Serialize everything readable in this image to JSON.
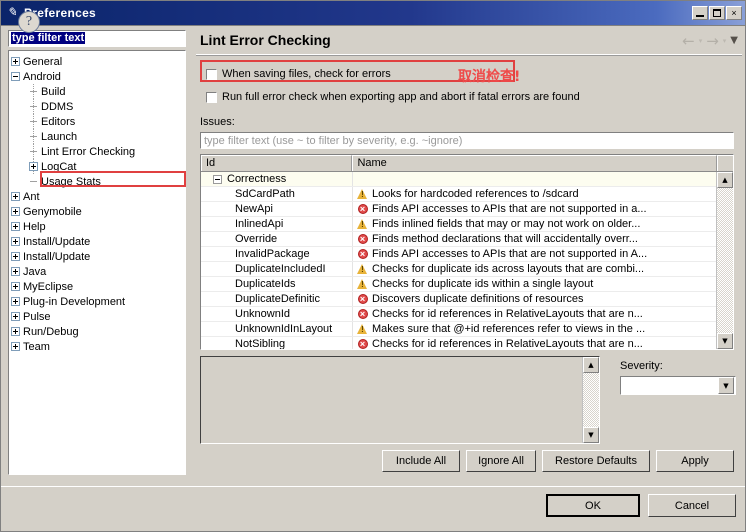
{
  "window": {
    "title": "Preferences",
    "icon": "preferences-icon",
    "buttons": {
      "minimize": "minimize-icon",
      "maximize": "maximize-icon",
      "close": "×"
    }
  },
  "sidebar": {
    "filter": {
      "value": "type filter text",
      "placeholder": "type filter text"
    },
    "tree": [
      {
        "label": "General",
        "level": 0,
        "toggle": "plus"
      },
      {
        "label": "Android",
        "level": 0,
        "toggle": "minus"
      },
      {
        "label": "Build",
        "level": 1,
        "toggle": "none"
      },
      {
        "label": "DDMS",
        "level": 1,
        "toggle": "none"
      },
      {
        "label": "Editors",
        "level": 1,
        "toggle": "none"
      },
      {
        "label": "Launch",
        "level": 1,
        "toggle": "none"
      },
      {
        "label": "Lint Error Checking",
        "level": 1,
        "toggle": "none",
        "highlighted": true
      },
      {
        "label": "LogCat",
        "level": 1,
        "toggle": "plus"
      },
      {
        "label": "Usage Stats",
        "level": 1,
        "toggle": "none"
      },
      {
        "label": "Ant",
        "level": 0,
        "toggle": "plus"
      },
      {
        "label": "Genymobile",
        "level": 0,
        "toggle": "plus"
      },
      {
        "label": "Help",
        "level": 0,
        "toggle": "plus"
      },
      {
        "label": "Install/Update",
        "level": 0,
        "toggle": "plus"
      },
      {
        "label": "Install/Update",
        "level": 0,
        "toggle": "plus"
      },
      {
        "label": "Java",
        "level": 0,
        "toggle": "plus"
      },
      {
        "label": "MyEclipse",
        "level": 0,
        "toggle": "plus"
      },
      {
        "label": "Plug-in Development",
        "level": 0,
        "toggle": "plus"
      },
      {
        "label": "Pulse",
        "level": 0,
        "toggle": "plus"
      },
      {
        "label": "Run/Debug",
        "level": 0,
        "toggle": "plus"
      },
      {
        "label": "Team",
        "level": 0,
        "toggle": "plus"
      }
    ]
  },
  "main": {
    "title": "Lint Error Checking",
    "nav": {
      "back": "←",
      "back_caret": "▾",
      "forward": "→",
      "forward_caret": "▾",
      "menu": "▼"
    },
    "checkboxes": [
      {
        "label": "When saving files, check for errors",
        "checked": false,
        "highlighted": true
      },
      {
        "label": "Run full error check when exporting app and abort if fatal errors are found",
        "checked": false,
        "highlighted": false
      }
    ],
    "annotation": {
      "text": "取消检查!",
      "color": "#ef4a4a"
    },
    "issues": {
      "label": "Issues:",
      "filter_placeholder": "type filter text (use ~ to filter by severity, e.g. ~ignore)",
      "columns": [
        "Id",
        "Name"
      ],
      "rows": [
        {
          "id": "Correctness",
          "name": "",
          "icon": "none",
          "group": true
        },
        {
          "id": "SdCardPath",
          "name": "Looks for hardcoded references to /sdcard",
          "icon": "warning",
          "group": false
        },
        {
          "id": "NewApi",
          "name": "Finds API accesses to APIs that are not supported in a...",
          "icon": "error",
          "group": false
        },
        {
          "id": "InlinedApi",
          "name": "Finds inlined fields that may or may not work on older...",
          "icon": "warning",
          "group": false
        },
        {
          "id": "Override",
          "name": "Finds method declarations that will accidentally overr...",
          "icon": "error",
          "group": false
        },
        {
          "id": "InvalidPackage",
          "name": "Finds API accesses to APIs that are not supported in A...",
          "icon": "error",
          "group": false
        },
        {
          "id": "DuplicateIncludedI",
          "name": "Checks for duplicate ids across layouts that are combi...",
          "icon": "warning",
          "group": false
        },
        {
          "id": "DuplicateIds",
          "name": "Checks for duplicate ids within a single layout",
          "icon": "warning",
          "group": false
        },
        {
          "id": "DuplicateDefinitic",
          "name": "Discovers duplicate definitions of resources",
          "icon": "error",
          "group": false
        },
        {
          "id": "UnknownId",
          "name": "Checks for id references in RelativeLayouts that are n...",
          "icon": "error",
          "group": false
        },
        {
          "id": "UnknownIdInLayout",
          "name": "Makes sure that @+id references refer to views in the ...",
          "icon": "warning",
          "group": false
        },
        {
          "id": "NotSibling",
          "name": "Checks for id references in RelativeLayouts that are n...",
          "icon": "error",
          "group": false
        }
      ]
    },
    "description": {
      "text": ""
    },
    "severity": {
      "label": "Severity:",
      "value": "",
      "arrow": "▼"
    },
    "action_buttons": [
      {
        "label": "Include All"
      },
      {
        "label": "Ignore All"
      },
      {
        "label": "Restore Defaults"
      },
      {
        "label": "Apply"
      }
    ]
  },
  "footer": {
    "help_icon": "?",
    "ok_label": "OK",
    "cancel_label": "Cancel"
  }
}
